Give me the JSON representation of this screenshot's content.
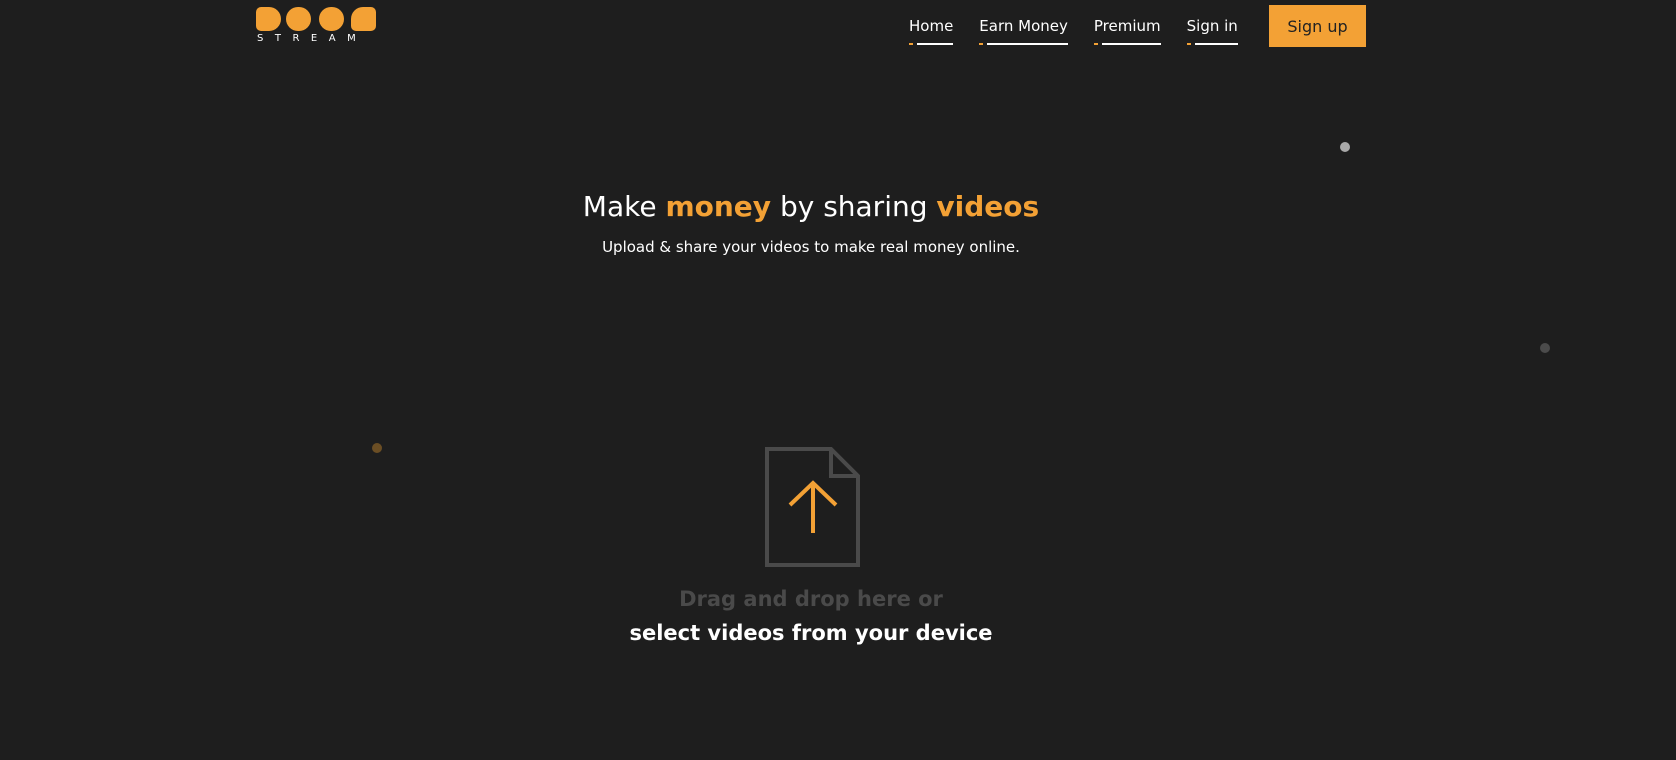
{
  "header": {
    "logo": {
      "wordmark": "STREAM"
    },
    "nav": [
      {
        "label": "Home"
      },
      {
        "label": "Earn Money"
      },
      {
        "label": "Premium"
      },
      {
        "label": "Sign in"
      }
    ],
    "signup_label": "Sign up"
  },
  "hero": {
    "title_part1": "Make ",
    "title_accent1": "money",
    "title_part2": " by sharing ",
    "title_accent2": "videos",
    "subtitle": "Upload & share your videos to make real money online."
  },
  "upload": {
    "icon": "file-upload-icon",
    "drag_text": "Drag and drop here or",
    "select_text": "select videos from your device"
  },
  "colors": {
    "background": "#1e1e1e",
    "accent": "#f3a135",
    "text": "#ffffff",
    "muted_text": "#4a4a4a",
    "icon_outline": "#4a4a4a"
  }
}
